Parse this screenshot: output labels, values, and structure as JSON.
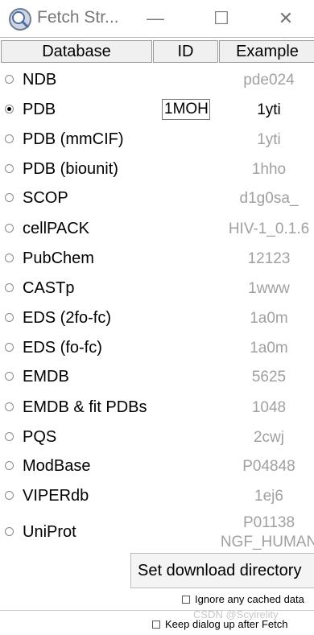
{
  "window": {
    "title": "Fetch Str...",
    "minimize_glyph": "—",
    "maximize_glyph": "☐",
    "close_glyph": "✕",
    "icon": "chimera-app-icon"
  },
  "headers": {
    "database": "Database",
    "id": "ID",
    "example": "Example"
  },
  "rows": [
    {
      "label": "NDB",
      "example": "pde024",
      "selected": false
    },
    {
      "label": "PDB",
      "example": "1yti",
      "selected": true,
      "id_value": "1MOH"
    },
    {
      "label": "PDB (mmCIF)",
      "example": "1yti",
      "selected": false
    },
    {
      "label": "PDB (biounit)",
      "example": "1hho",
      "selected": false
    },
    {
      "label": "SCOP",
      "example": "d1g0sa_",
      "selected": false
    },
    {
      "label": "cellPACK",
      "example": "HIV-1_0.1.6",
      "selected": false
    },
    {
      "label": "PubChem",
      "example": "12123",
      "selected": false
    },
    {
      "label": "CASTp",
      "example": "1www",
      "selected": false
    },
    {
      "label": "EDS (2fo-fc)",
      "example": "1a0m",
      "selected": false
    },
    {
      "label": "EDS (fo-fc)",
      "example": "1a0m",
      "selected": false
    },
    {
      "label": "EMDB",
      "example": "5625",
      "selected": false
    },
    {
      "label": "EMDB & fit PDBs",
      "example": "1048",
      "selected": false
    },
    {
      "label": "PQS",
      "example": "2cwj",
      "selected": false
    },
    {
      "label": "ModBase",
      "example": "P04848",
      "selected": false
    },
    {
      "label": "VIPERdb",
      "example": "1ej6",
      "selected": false
    },
    {
      "label": "UniProt",
      "example_line1": "P01138",
      "example_line2": "NGF_HUMAN",
      "selected": false
    }
  ],
  "buttons": {
    "set_download_directory": "Set download directory"
  },
  "options": {
    "ignore_cache": "Ignore any cached data",
    "keep_dialog": "Keep dialog up after Fetch"
  },
  "watermark": "CSDN @Scyirelity",
  "colors": {
    "example_inactive": "#a0a0a0",
    "header_bg": "#f0f0f0",
    "titlebar_text": "#777777"
  }
}
